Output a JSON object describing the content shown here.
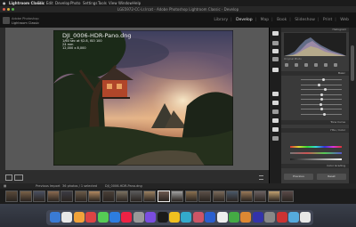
{
  "menubar": {
    "app_menu": "Lightroom Classic",
    "items": [
      "File",
      "Edit",
      "Develop",
      "Photo",
      "Settings",
      "Tools",
      "View",
      "Window",
      "Help"
    ]
  },
  "window": {
    "title": "LGE5972-CC-Lr.lrcat - Adobe Photoshop Lightroom Classic - Develop"
  },
  "identity_plate": {
    "line1": "Lightroom Classic",
    "line2": "Adobe Photoshop"
  },
  "modules": [
    "Library",
    "Develop",
    "Map",
    "Book",
    "Slideshow",
    "Print",
    "Web"
  ],
  "active_module": "Develop",
  "photo_info": {
    "filename": "DJI_0006-HDR-Pano.dng",
    "line2": "1/60 sec at f/2.8, ISO 100",
    "line3": "24 mm",
    "line4": "12,000 x 8,000"
  },
  "filmstrip": {
    "source_label": "Previous Import",
    "count_label": "36 photos / 1 selected",
    "selected_file": "DJI_0006-HDR-Pano.dng",
    "thumb_count": 21,
    "selected_index": 11
  },
  "right_panel": {
    "histogram_label": "Histogram",
    "original_label": "Original Photo",
    "sections": [
      "Basic",
      "Tone Curve",
      "HSL / Color",
      "Color Grading",
      "Detail"
    ],
    "sliders": [
      0.55,
      0.45,
      0.6,
      0.5,
      0.52,
      0.48,
      0.5,
      0.57
    ],
    "previous_button": "Previous",
    "reset_button": "Reset"
  },
  "colors": {
    "accent": "#e6e6e6",
    "panel": "#3a3a3a",
    "workarea": "#585858"
  }
}
